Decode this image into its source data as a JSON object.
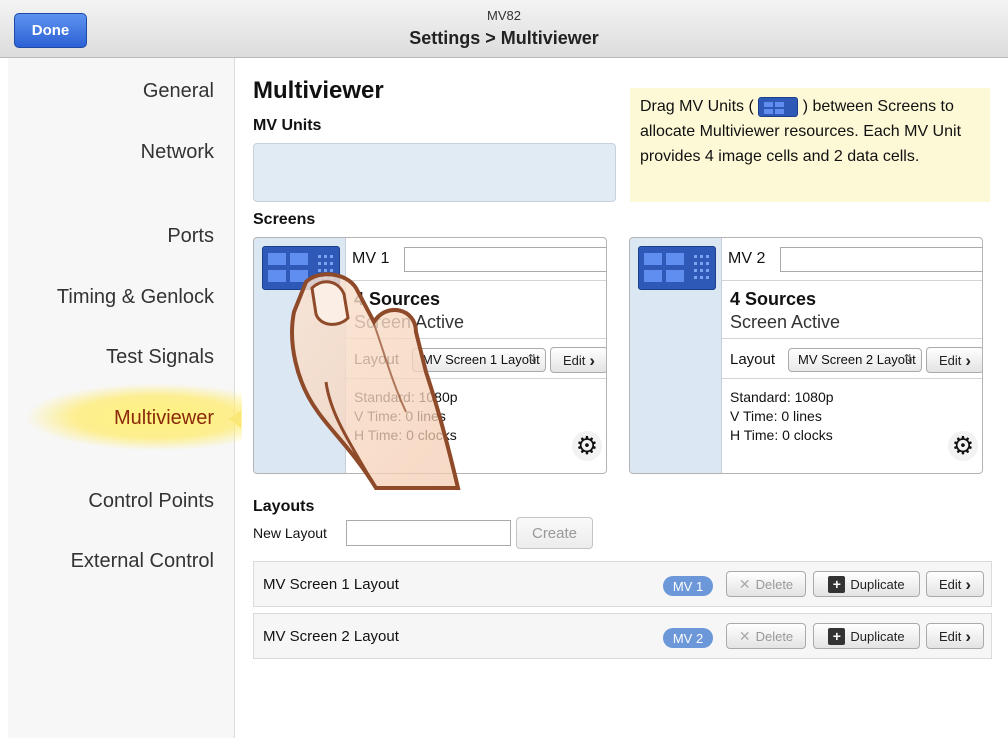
{
  "header": {
    "device_name": "MV82",
    "title": "Settings > Multiviewer",
    "done_label": "Done"
  },
  "sidebar": {
    "items": [
      {
        "label": "General"
      },
      {
        "label": "Network"
      },
      {
        "label": "Ports"
      },
      {
        "label": "Timing & Genlock"
      },
      {
        "label": "Test Signals"
      },
      {
        "label": "Multiviewer",
        "active": true
      },
      {
        "label": "Control Points"
      },
      {
        "label": "External Control"
      }
    ]
  },
  "main": {
    "title": "Multiviewer",
    "mv_units_heading": "MV Units",
    "help_text_before": "Drag MV Units (",
    "help_text_after": ") between Screens to allocate Multiviewer resources. Each MV Unit provides 4 image cells and 2 data cells.",
    "screens_heading": "Screens",
    "screens": [
      {
        "name": "MV 1",
        "name_value": "",
        "sources": "4 Sources",
        "status": "Screen Active",
        "layout_label": "Layout",
        "layout_selected": "MV Screen 1 Layout",
        "edit_label": "Edit",
        "standard": "Standard: 1080p",
        "v_time": "V Time: 0 lines",
        "h_time": "H Time: 0 clocks"
      },
      {
        "name": "MV 2",
        "name_value": "",
        "sources": "4 Sources",
        "status": "Screen Active",
        "layout_label": "Layout",
        "layout_selected": "MV Screen 2 Layout",
        "edit_label": "Edit",
        "standard": "Standard: 1080p",
        "v_time": "V Time: 0 lines",
        "h_time": "H Time: 0 clocks"
      }
    ],
    "layouts_heading": "Layouts",
    "new_layout_label": "New Layout",
    "new_layout_value": "",
    "create_label": "Create",
    "layouts": [
      {
        "name": "MV Screen 1 Layout",
        "badge": "MV 1",
        "delete_label": "Delete",
        "duplicate_label": "Duplicate",
        "edit_label": "Edit"
      },
      {
        "name": "MV Screen 2 Layout",
        "badge": "MV 2",
        "delete_label": "Delete",
        "duplicate_label": "Duplicate",
        "edit_label": "Edit"
      }
    ]
  },
  "icons": {
    "gear": "gear-icon",
    "chevron": "chevron-right-icon",
    "mv_unit": "mv-unit-icon",
    "duplicate": "duplicate-icon",
    "delete": "x-icon",
    "hand": "pointing-hand-icon"
  },
  "colors": {
    "done_button": "#2b61d4",
    "active_nav_text": "#8a2a0a",
    "highlight_glow": "#f9e777",
    "mv_unit_blue": "#2f59b7",
    "badge_blue": "#6c97d8",
    "help_bg": "#fdf8d6"
  }
}
